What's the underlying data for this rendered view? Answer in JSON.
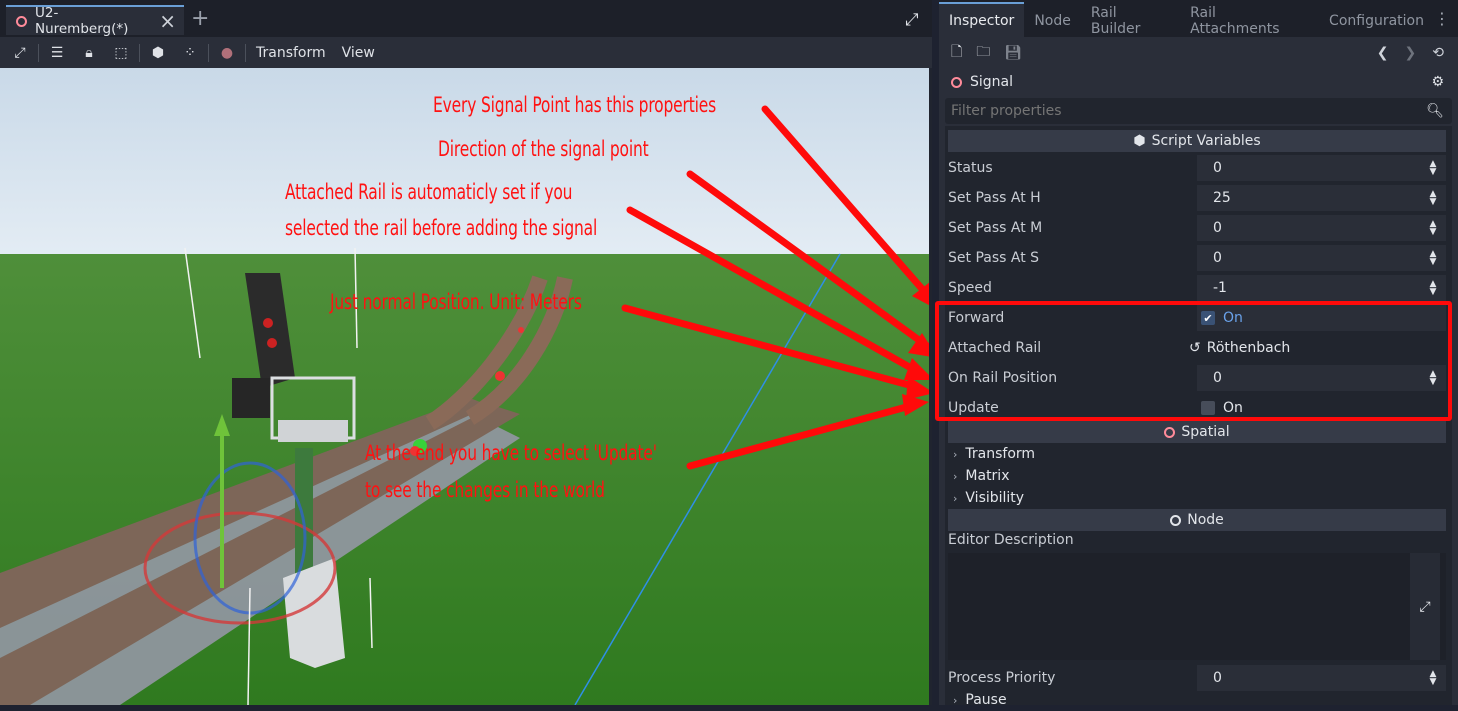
{
  "editor": {
    "scene_tab": "U2-Nuremberg(*)",
    "toolbar_menus": [
      "Transform",
      "View"
    ]
  },
  "annotations": [
    "Every Signal Point has this properties",
    "Direction of the signal point",
    "Attached Rail is automaticly set if you",
    "selected the rail before adding the signal",
    "Just normal Position. Unit: Meters",
    "At the end you have to select 'Update'",
    "to see the changes in the world"
  ],
  "inspector": {
    "tabs": [
      "Inspector",
      "Node",
      "Rail Builder",
      "Rail Attachments",
      "Configuration"
    ],
    "object_name": "Signal",
    "filter_placeholder": "Filter properties",
    "sections": {
      "script_variables": "Script Variables",
      "spatial": "Spatial",
      "node": "Node"
    },
    "properties": [
      {
        "label": "Status",
        "value": "0"
      },
      {
        "label": "Set Pass At H",
        "value": "25"
      },
      {
        "label": "Set Pass At M",
        "value": "0"
      },
      {
        "label": "Set Pass At S",
        "value": "0"
      },
      {
        "label": "Speed",
        "value": "-1"
      }
    ],
    "forward": {
      "label": "Forward",
      "value": "On",
      "checked": true
    },
    "attached_rail": {
      "label": "Attached Rail",
      "value": "Röthenbach"
    },
    "on_rail_position": {
      "label": "On Rail Position",
      "value": "0"
    },
    "update": {
      "label": "Update",
      "value": "On",
      "checked": false
    },
    "spatial_groups": [
      "Transform",
      "Matrix",
      "Visibility"
    ],
    "editor_description": "Editor Description",
    "process_priority": {
      "label": "Process Priority",
      "value": "0"
    },
    "pause": "Pause"
  },
  "colors": {
    "annotation_red": "#ff1212",
    "accent_blue": "#6a9fd6",
    "sky": "#d8e6f1",
    "grass": "#3f8a2a"
  }
}
